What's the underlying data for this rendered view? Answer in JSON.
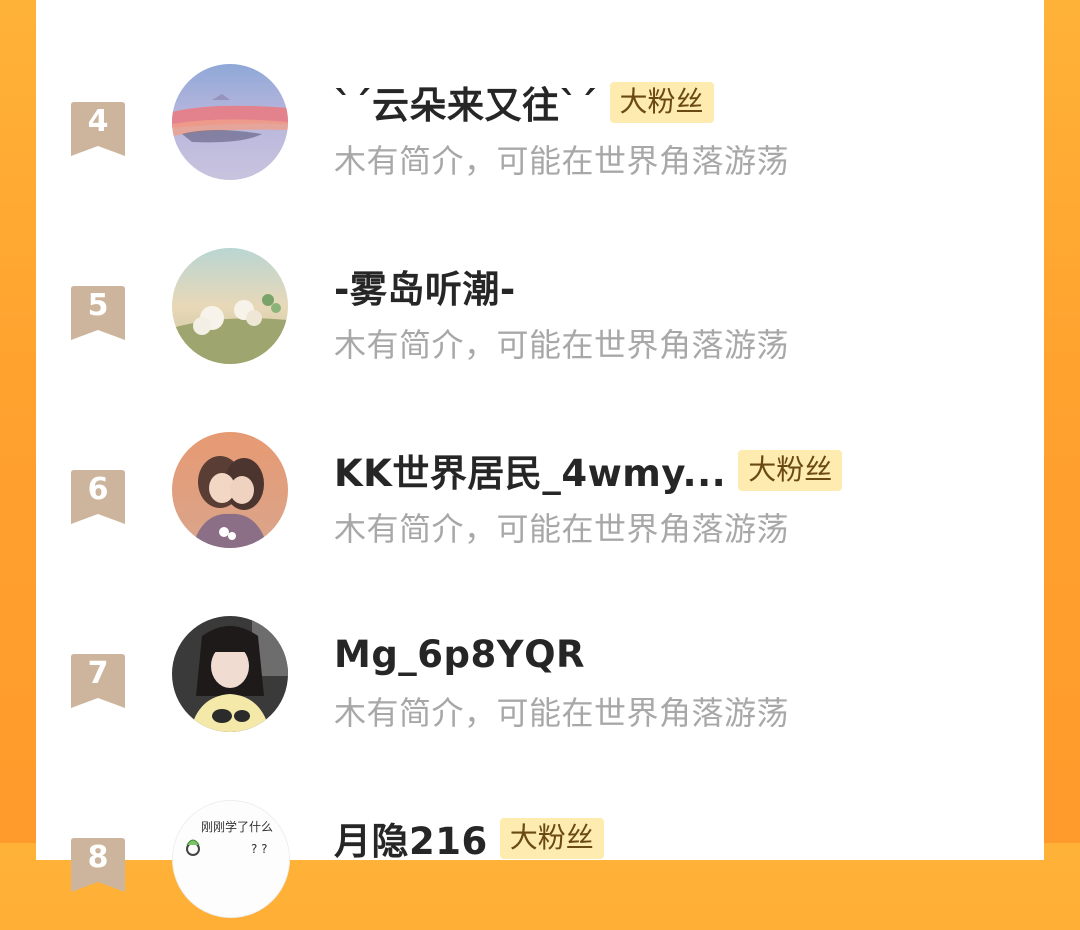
{
  "fans": [
    {
      "rank": "4",
      "name": "ˋˊ云朵来又往ˋˊ",
      "badge": "大粉丝",
      "bio": "木有简介，可能在世界角落游荡",
      "avatar_icon": "sunset-clouds-avatar"
    },
    {
      "rank": "5",
      "name": "-雾岛听潮-",
      "badge": "",
      "bio": "木有简介，可能在世界角落游荡",
      "avatar_icon": "flower-field-avatar"
    },
    {
      "rank": "6",
      "name": "KK世界居民_4wmy...",
      "badge": "大粉丝",
      "bio": "木有简介，可能在世界角落游荡",
      "avatar_icon": "illustrated-girls-avatar"
    },
    {
      "rank": "7",
      "name": "Mg_6p8YQR",
      "badge": "",
      "bio": "木有简介，可能在世界角落游荡",
      "avatar_icon": "girl-photo-avatar"
    },
    {
      "rank": "8",
      "name": "月隐216",
      "badge": "大粉丝",
      "bio": "",
      "avatar_icon": "doodle-sketch-avatar"
    }
  ],
  "doodle_text": "刚刚学了什么",
  "colors": {
    "rank_ribbon": "#cdb59d",
    "badge_bg": "#fdebb0",
    "background_orange": "#ffa22e",
    "name": "#262626",
    "bio": "#a8a8a8"
  }
}
